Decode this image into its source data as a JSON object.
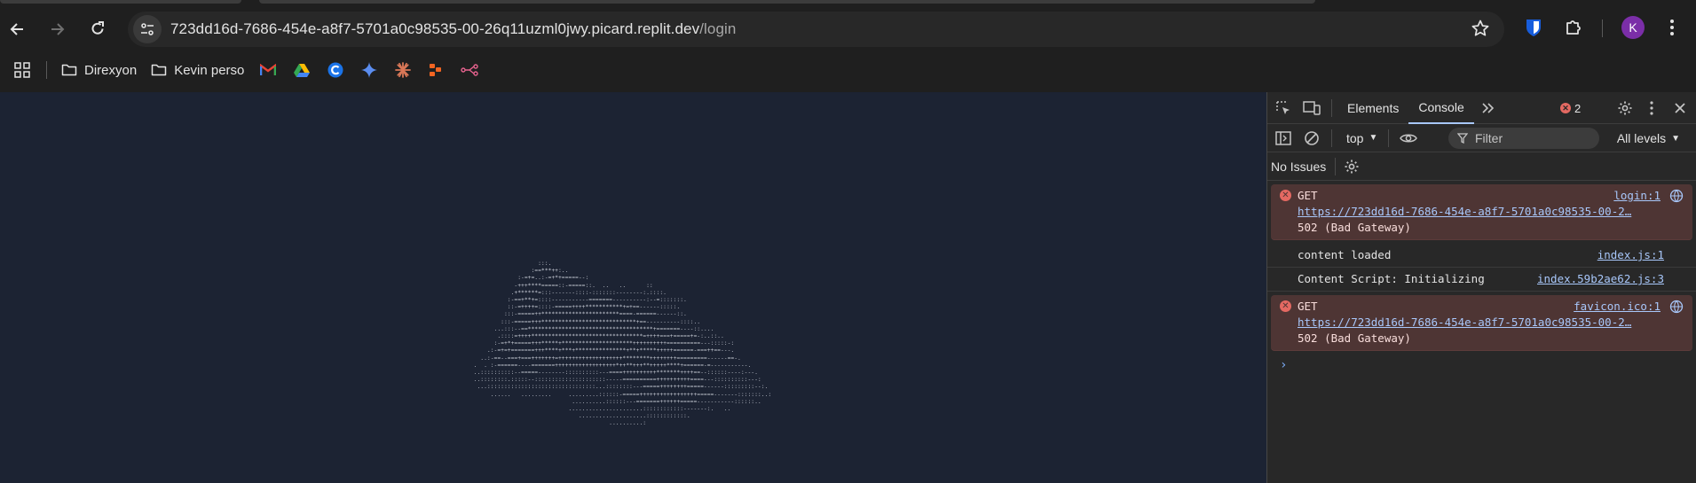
{
  "toolbar": {
    "url_host": "723dd16d-7686-454e-a8f7-5701a0c98535-00-26q11uzml0jwy.picard.replit.dev",
    "url_path": "/login",
    "avatar_letter": "K"
  },
  "bookmarks": {
    "folder1": "Direxyon",
    "folder2": "Kevin perso"
  },
  "page": {
    "ascii_art": "                    :::.\n                  :==***++:..\n              :-=+=..:-=+*+=====--:\n             -+++****=====::-=====::.  ..   ..      ::\n            .+******=:::-------::::-:::::::--------:.::::.\n           :-==+**+=::::-----------=======----------:--=:::::::.\n           ::-=++++=::::-=====++++***********+=+==------:::::.\n          :::-=====++***********************====-======------::.\n         :::-=====+++****************************+==----------::::..\n       ...:::--==*************************************+=======----::....\n        .::::=++++*********************************=++++===+=====+=-:..::..\n       :-=+*+=====+++*****+*********************++++++++++==========---:::::-:\n     .:-=+=+=======+++****+***+***************+**+*****+++++======-===++==---.\n   ..:-==--===+===+++++++=+++++++++++++++++++********++++++++=========------==-.\n .  . :-======----=======++++++++++++++++++*++**+++**+++++****+======-=-----------.\n ..::::::::::--=====--------::::::::::---====++++++++++*******++++==--::::::----:---.\n ..::::::::.:::::--:::::::::::::::::::::-----==========++++++++++====---::::::::::---:\n  ...::::::::::::::::::::::::::::::::...::::::::---=====++++++++=====------:::::::::--:.\n      ......   .........     .........::::::-=====+++++++++++++++++=====-------:::::::..:\n                              ..........::::::---=======++++++=====-----------::::::..\n                             ......................::::::::::::-------:.   ..\n                                ....................::::::::::::.\n                                         ..........:"
  },
  "devtools": {
    "tabs": [
      "Elements",
      "Console"
    ],
    "error_count": "2",
    "context": "top",
    "filter_placeholder": "Filter",
    "levels": "All levels",
    "issues": "No Issues",
    "messages": [
      {
        "type": "error",
        "method": "GET",
        "url": "https://723dd16d-7686-454e-a8f7-5701a0c98535-00-2…",
        "status": "502 (Bad Gateway)",
        "source": "login:1"
      },
      {
        "type": "info",
        "text": "content loaded",
        "source": "index.js:1"
      },
      {
        "type": "info",
        "text": "Content Script: Initializing",
        "source": "index.59b2ae62.js:3"
      },
      {
        "type": "error",
        "method": "GET",
        "url": "https://723dd16d-7686-454e-a8f7-5701a0c98535-00-2…",
        "status": "502 (Bad Gateway)",
        "source": "favicon.ico:1"
      }
    ],
    "prompt": "›"
  }
}
